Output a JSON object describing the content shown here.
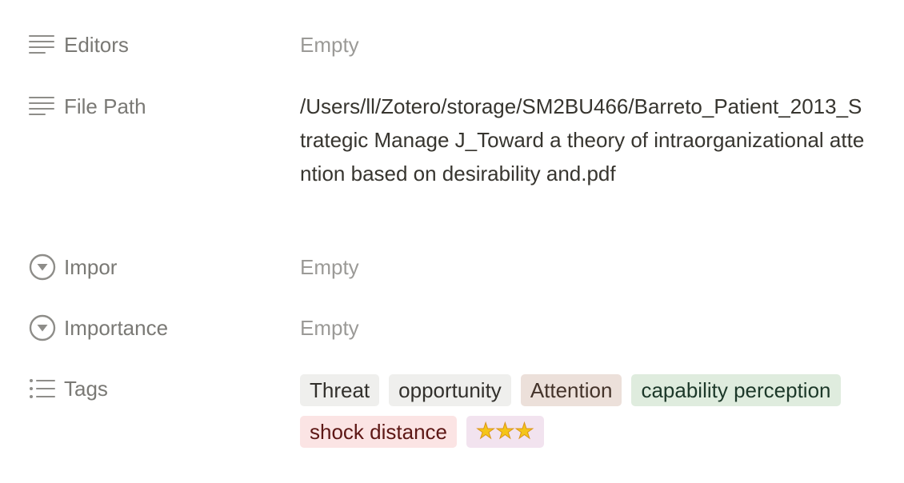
{
  "properties": {
    "editors": {
      "label": "Editors",
      "value": "Empty",
      "icon": "text-lines-icon"
    },
    "file_path": {
      "label": "File Path",
      "value": "/Users/ll/Zotero/storage/SM2BU466/Barreto_Patient_2013_Strategic Manage J_Toward a theory of intraorganizational attention based on desirability and.pdf",
      "icon": "text-lines-icon"
    },
    "impor": {
      "label": "Impor",
      "value": "Empty",
      "icon": "select-circle-arrow-icon"
    },
    "importance": {
      "label": "Importance",
      "value": "Empty",
      "icon": "select-circle-arrow-icon"
    },
    "tags": {
      "label": "Tags",
      "icon": "list-bullets-icon",
      "items": [
        {
          "label": "Threat",
          "color": "gray"
        },
        {
          "label": "opportunity",
          "color": "gray"
        },
        {
          "label": "Attention",
          "color": "brown"
        },
        {
          "label": "capability perception",
          "color": "green"
        },
        {
          "label": "shock distance",
          "color": "red"
        },
        {
          "label": "⭐⭐⭐",
          "color": "purple"
        }
      ]
    }
  },
  "colors": {
    "label": "#7a7975",
    "value_text": "#37352f",
    "empty_text": "#9b9a97",
    "tag_gray": "#efefed",
    "tag_brown": "#ece0da",
    "tag_green": "#dfecde",
    "tag_red": "#fbe4e4",
    "tag_purple": "#f2e3ef"
  }
}
